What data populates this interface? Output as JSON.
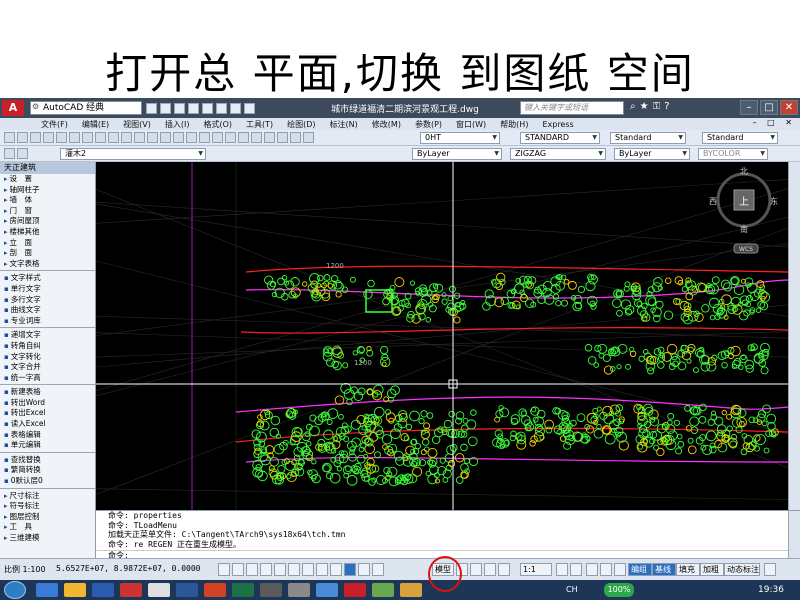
{
  "slide": {
    "title": "打开总 平面,切换 到图纸 空间"
  },
  "titlebar": {
    "logo": "A",
    "workspace": "AutoCAD 经典",
    "document_title": "城市绿道福清二期滨河景观工程.dwg",
    "search_placeholder": "键入关键字或短语"
  },
  "menubar": {
    "items": [
      "文件(F)",
      "编辑(E)",
      "视图(V)",
      "插入(I)",
      "格式(O)",
      "工具(T)",
      "绘图(D)",
      "标注(N)",
      "修改(M)",
      "参数(P)",
      "窗口(W)",
      "帮助(H)",
      "Express"
    ]
  },
  "toolbar1": {
    "layer_combo": "0HT",
    "text_style": "STANDARD",
    "dim_style": "Standard",
    "table_style": "Standard"
  },
  "toolbar2": {
    "layer_current": "灌木2",
    "color": "ByLayer",
    "linetype": "ZIGZAG",
    "lineweight": "ByLayer",
    "plotstyle": "BYCOLOR"
  },
  "left_panel": {
    "header": "天正建筑",
    "group1": [
      "设　置",
      "轴网柱子",
      "墙　体",
      "门　窗",
      "房间屋顶",
      "楼梯其他",
      "立　面",
      "剖　面",
      "文字表格"
    ],
    "group2": [
      "文字样式",
      "单行文字",
      "多行文字",
      "曲线文字",
      "专业词库"
    ],
    "group3": [
      "递增文字",
      "转角自纠",
      "文字转化",
      "文字合并",
      "统一字高"
    ],
    "group4": [
      "新建表格",
      "转出Word",
      "转出Excel",
      "读入Excel",
      "表格编辑",
      "单元编辑"
    ],
    "group5": [
      "查找替换",
      "繁简转换",
      "0默认层0"
    ],
    "group6": [
      "尺寸标注",
      "符号标注",
      "图层控制",
      "工　具",
      "三维建模"
    ]
  },
  "viewcube": {
    "north": "北",
    "south": "南",
    "east": "东",
    "west": "西",
    "top": "上",
    "wcs": "WCS"
  },
  "drawing": {
    "label1": "1200",
    "label2": "1200"
  },
  "command": {
    "lines": [
      "命令: properties",
      "命令: TLoadMenu",
      "加载天正菜单文件: C:\\Tangent\\TArch9\\sys18x64\\tch.tmn",
      "命令: re REGEN 正在重生成模型。",
      "命令:"
    ]
  },
  "status": {
    "scale": "比例 1:100",
    "coords": "5.6527E+07, 8.9872E+07, 0.0000",
    "model_tab": "模型",
    "annot_scale": "1:1",
    "buttons": [
      "编组",
      "基线",
      "填充",
      "加粗",
      "动态标注"
    ]
  },
  "taskbar": {
    "lang": "CH",
    "battery": "100%",
    "time": "19:36"
  },
  "colors": {
    "canvas_bg": "#000000",
    "green": "#3cff3c",
    "magenta": "#ff30ff",
    "red": "#ff2020",
    "crosshair": "#ffffff",
    "highlight": "#e01010"
  }
}
